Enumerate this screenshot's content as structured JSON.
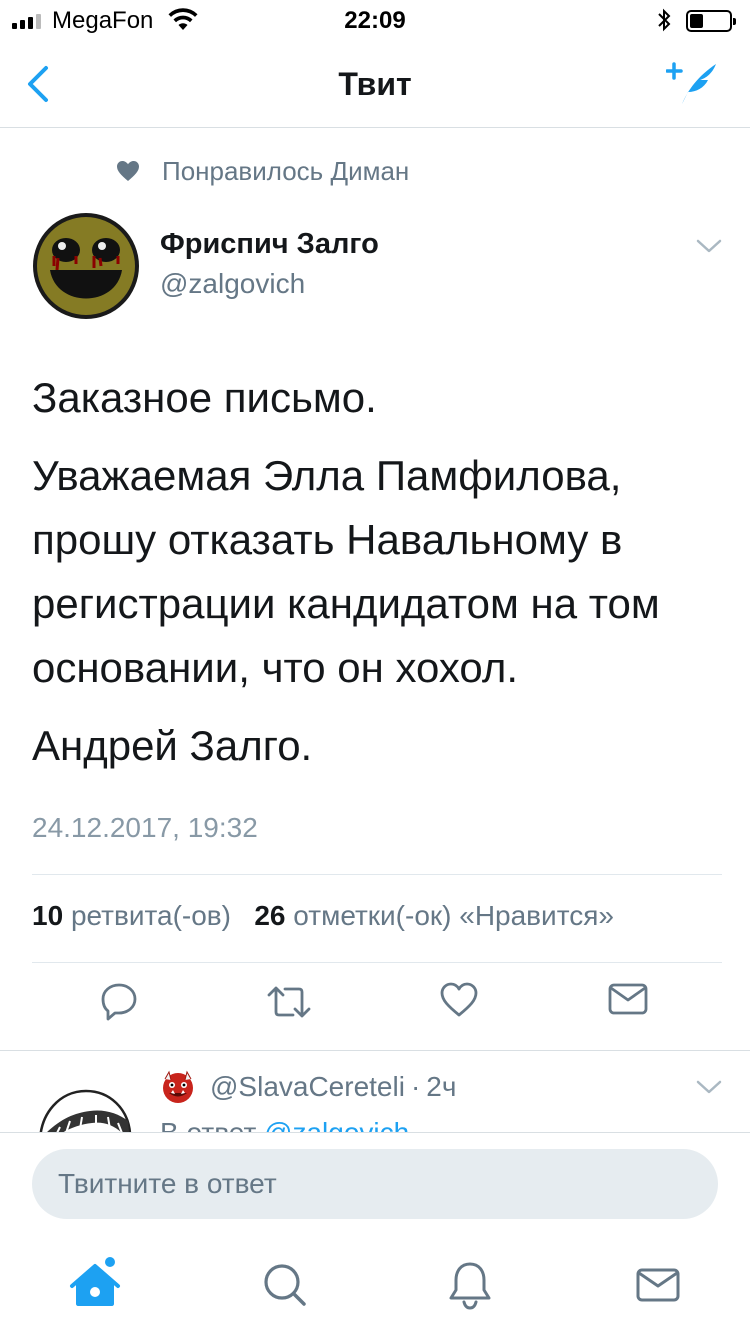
{
  "status_bar": {
    "carrier": "MegaFon",
    "time": "22:09",
    "battery_level": 0.35
  },
  "nav": {
    "title": "Твит",
    "back_icon": "chevron-left-icon",
    "compose_icon": "compose-tweet-icon"
  },
  "social_context": {
    "icon": "heart-icon",
    "text": "Понравилось Диман"
  },
  "tweet": {
    "author_name": "Фриспич Залго",
    "author_handle": "@zalgovich",
    "paragraphs": [
      "Заказное письмо.",
      "Уважаемая Элла Памфилова, прошу отказать Навальному в регистрации кандидатом на том основании, что он хохол.",
      "Андрей Залго."
    ],
    "date": "24.12.2017, 19:32",
    "retweet_count": "10",
    "retweet_label": "ретвита(-ов)",
    "like_count": "26",
    "like_label": "отметки(-ок) «Нравится»"
  },
  "actions": [
    "reply-icon",
    "retweet-icon",
    "like-icon",
    "message-icon"
  ],
  "reply_preview": {
    "handle": "@SlavaCereteli",
    "separator": "·",
    "time": "2ч",
    "line2_prefix": "В ответ",
    "line2_mention": "@zalgovich"
  },
  "composer": {
    "placeholder": "Твитните в ответ"
  },
  "tabbar": {
    "items": [
      "home-icon",
      "search-icon",
      "notifications-icon",
      "messages-icon"
    ],
    "accent": "#1da1f2",
    "inactive": "#657786"
  }
}
